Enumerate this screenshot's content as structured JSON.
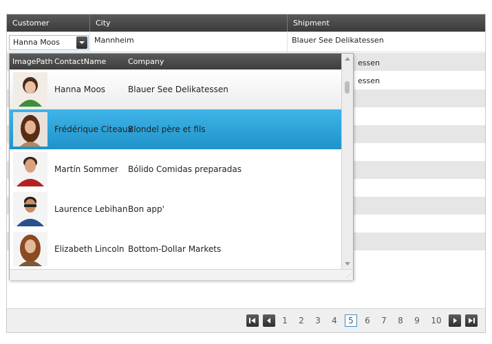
{
  "grid": {
    "columns": [
      "Customer",
      "City",
      "Shipment"
    ],
    "editor_value": "Hanna Moos",
    "first_row": {
      "city": "Mannheim",
      "shipment": "Blauer See Delikatessen"
    },
    "partial_shipments": [
      "essen",
      "essen"
    ]
  },
  "dropdown": {
    "columns": [
      "ImagePath",
      "ContactName",
      "Company"
    ],
    "items": [
      {
        "name": "Hanna Moos",
        "company": "Blauer See Delikatessen",
        "state": "hover"
      },
      {
        "name": "Frédérique Citeaux",
        "company": "Blondel père et fils",
        "state": "selected"
      },
      {
        "name": "Martín Sommer",
        "company": "Bólido Comidas preparadas",
        "state": "normal"
      },
      {
        "name": "Laurence Lebihan",
        "company": "Bon app'",
        "state": "normal"
      },
      {
        "name": "Elizabeth Lincoln",
        "company": "Bottom-Dollar Markets",
        "state": "normal"
      }
    ]
  },
  "pager": {
    "pages": [
      "1",
      "2",
      "3",
      "4",
      "5",
      "6",
      "7",
      "8",
      "9",
      "10"
    ],
    "current": "5"
  },
  "colors": {
    "accent": "#2aa3dc",
    "header": "#4a4a4a",
    "alt_row": "#e6e6e6"
  }
}
